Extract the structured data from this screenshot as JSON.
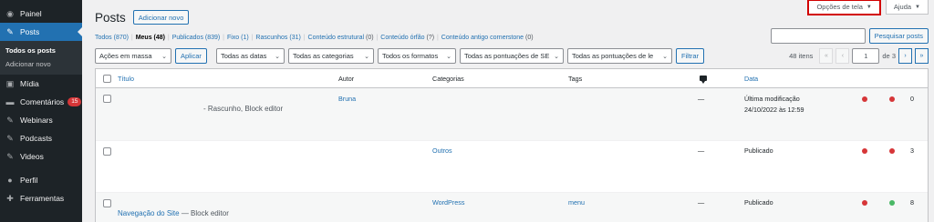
{
  "sidebar": {
    "items": [
      {
        "label": "Painel",
        "icon": "dashboard-icon"
      },
      {
        "label": "Posts",
        "icon": "pin-icon"
      },
      {
        "label": "Mídia",
        "icon": "media-icon"
      },
      {
        "label": "Comentários",
        "icon": "comment-icon",
        "badge": "15"
      },
      {
        "label": "Webinars",
        "icon": "pin-icon"
      },
      {
        "label": "Podcasts",
        "icon": "pin-icon"
      },
      {
        "label": "Videos",
        "icon": "pin-icon"
      },
      {
        "label": "Perfil",
        "icon": "user-icon"
      },
      {
        "label": "Ferramentas",
        "icon": "tools-icon"
      }
    ],
    "submenu": [
      "Todos os posts",
      "Adicionar novo"
    ]
  },
  "header": {
    "title": "Posts",
    "add_new": "Adicionar novo",
    "screen_options": "Opções de tela",
    "help": "Ajuda"
  },
  "views": {
    "all": "Todos (870)",
    "mine": "Meus (48)",
    "published": "Publicados (839)",
    "sticky": "Fixo (1)",
    "drafts": "Rascunhos (31)",
    "structural": "Conteúdo estrutural",
    "structural_count": "(0)",
    "orphan": "Conteúdo órfão",
    "orphan_count": "(?)",
    "cornerstone": "Conteúdo antigo cornerstone",
    "cornerstone_count": "(0)"
  },
  "search": {
    "button": "Pesquisar posts"
  },
  "filters": {
    "bulk": "Ações em massa",
    "apply": "Aplicar",
    "dates": "Todas as datas",
    "categories": "Todas as categorias",
    "formats": "Todos os formatos",
    "seo": "Todas as pontuações de SE",
    "readability": "Todas as pontuações de le",
    "filter": "Filtrar"
  },
  "pagination": {
    "items": "48 itens",
    "first": "«",
    "prev": "‹",
    "current": "1",
    "of": "de 3",
    "next": "›",
    "last": "»"
  },
  "table": {
    "columns": {
      "title": "Título",
      "author": "Autor",
      "categories": "Categorias",
      "tags": "Tags",
      "date": "Data"
    },
    "rows": [
      {
        "title": "",
        "state": "- Rascunho, Block editor",
        "author": "Bruna",
        "category": "",
        "tags": "",
        "comments": "—",
        "date_status": "Última modificação",
        "date": "24/10/2022 às 12:59",
        "seo": "red",
        "readability": "red",
        "links": "0"
      },
      {
        "title": "",
        "state": "",
        "author": "",
        "category": "Outros",
        "tags": "",
        "comments": "—",
        "date_status": "Publicado",
        "date": "",
        "seo": "red",
        "readability": "red",
        "links": "3"
      },
      {
        "title": "Navegação do Site",
        "state": " — Block editor",
        "author": "",
        "category": "WordPress",
        "tags": "menu",
        "comments": "—",
        "date_status": "Publicado",
        "date": "",
        "seo": "red",
        "readability": "green",
        "links": "8"
      }
    ]
  }
}
